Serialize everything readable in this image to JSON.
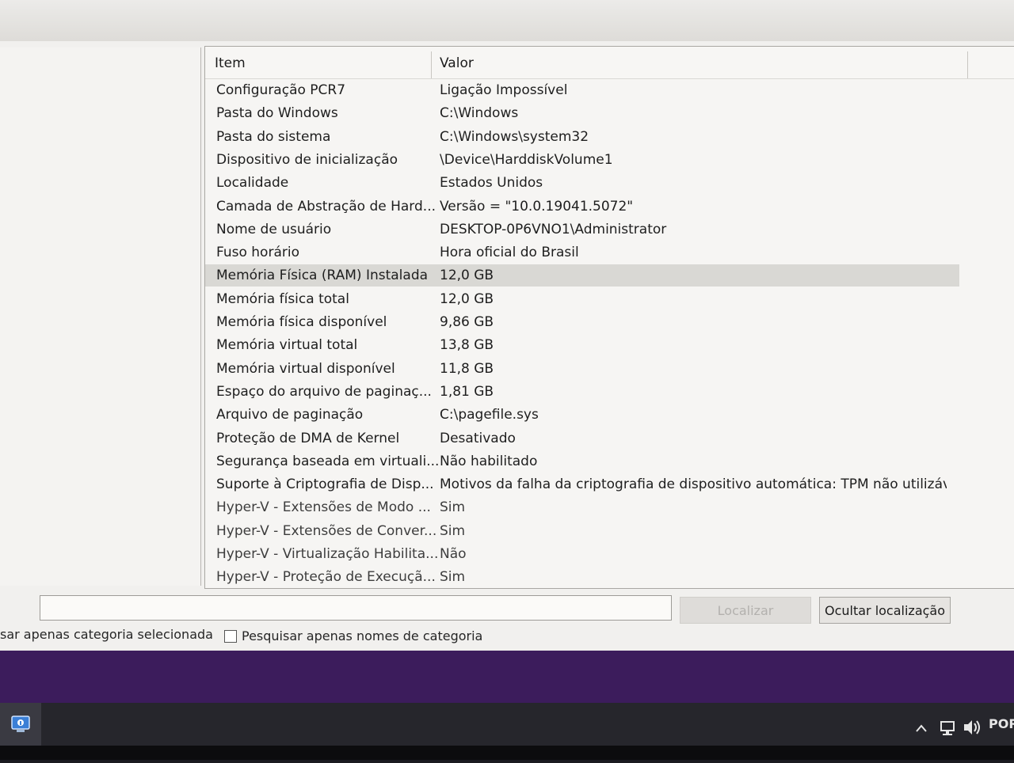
{
  "columns": {
    "item": "Item",
    "value": "Valor"
  },
  "rows": [
    {
      "item": "Configuração PCR7",
      "value": "Ligação Impossível"
    },
    {
      "item": "Pasta do Windows",
      "value": "C:\\Windows"
    },
    {
      "item": "Pasta do sistema",
      "value": "C:\\Windows\\system32"
    },
    {
      "item": "Dispositivo de inicialização",
      "value": "\\Device\\HarddiskVolume1"
    },
    {
      "item": "Localidade",
      "value": "Estados Unidos"
    },
    {
      "item": "Camada de Abstração de Hard...",
      "value": "Versão = \"10.0.19041.5072\""
    },
    {
      "item": "Nome de usuário",
      "value": "DESKTOP-0P6VNO1\\Administrator"
    },
    {
      "item": "Fuso horário",
      "value": "Hora oficial do Brasil"
    },
    {
      "item": "Memória Física (RAM) Instalada",
      "value": "12,0 GB"
    },
    {
      "item": "Memória física total",
      "value": "12,0 GB"
    },
    {
      "item": "Memória física disponível",
      "value": "9,86 GB"
    },
    {
      "item": "Memória virtual total",
      "value": "13,8 GB"
    },
    {
      "item": "Memória virtual disponível",
      "value": "11,8 GB"
    },
    {
      "item": "Espaço do arquivo de paginaç...",
      "value": "1,81 GB"
    },
    {
      "item": "Arquivo de paginação",
      "value": "C:\\pagefile.sys"
    },
    {
      "item": "Proteção de DMA de Kernel",
      "value": "Desativado"
    },
    {
      "item": "Segurança baseada em virtuali...",
      "value": "Não habilitado"
    },
    {
      "item": "Suporte à Criptografia de Disp...",
      "value": "Motivos da falha da criptografia de dispositivo automática: TPM não utilizáve..."
    },
    {
      "item": "Hyper-V - Extensões de Modo ...",
      "value": "Sim"
    },
    {
      "item": "Hyper-V - Extensões de Conver...",
      "value": "Sim"
    },
    {
      "item": "Hyper-V - Virtualização Habilita...",
      "value": "Não"
    },
    {
      "item": "Hyper-V - Proteção de Execuçã...",
      "value": "Sim"
    }
  ],
  "selected_row": "Memória Física (RAM) Instalada",
  "search": {
    "value": ""
  },
  "buttons": {
    "find": "Localizar",
    "hide_find": "Ocultar localização"
  },
  "options": {
    "selected_category_only": "sar apenas categoria selecionada",
    "category_names_only": "Pesquisar apenas nomes de categoria"
  },
  "tray": {
    "language": "POR"
  },
  "colors": {
    "selection": "#d9d8d4",
    "desktop": "#3c1c5c",
    "taskbar": "#26262c"
  }
}
